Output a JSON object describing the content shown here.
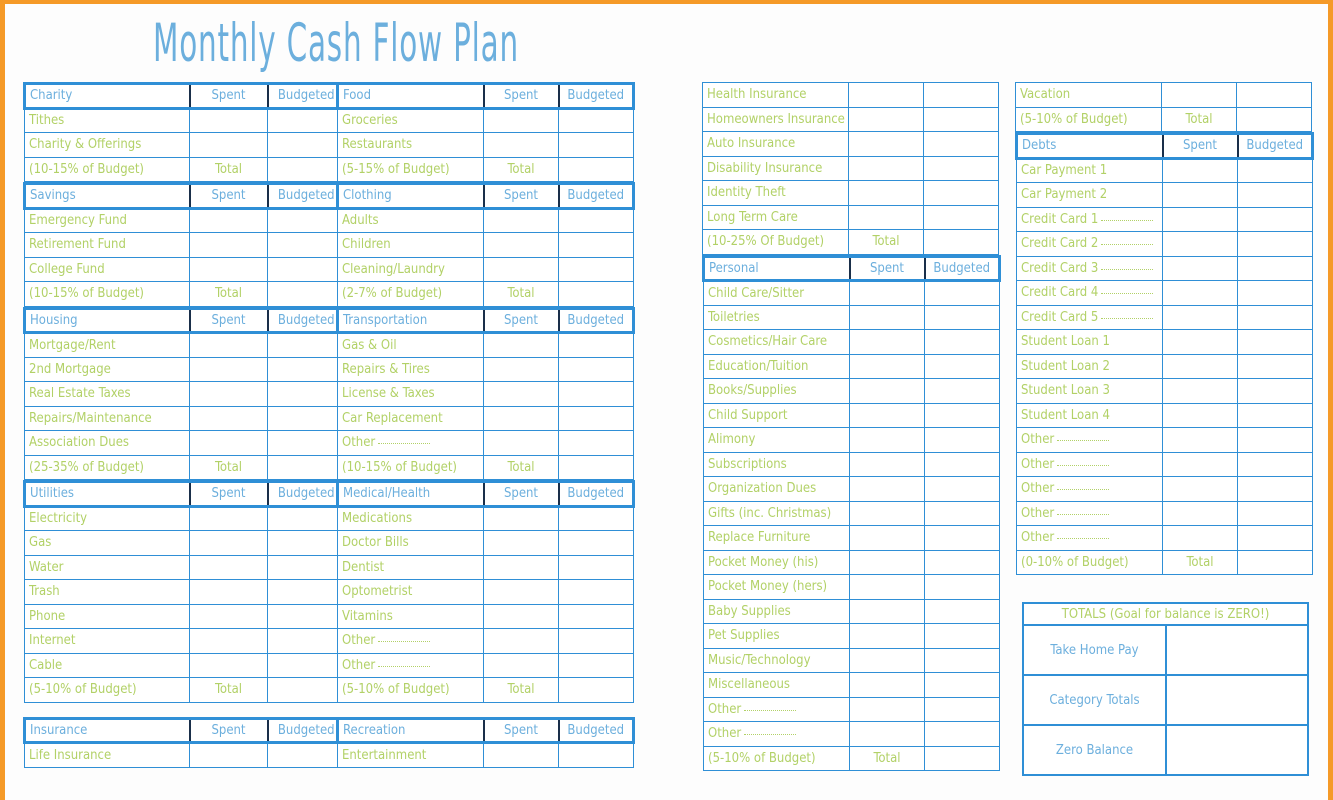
{
  "page": {
    "title": "Monthly Cash Flow Plan",
    "frame_color": "#f59a28",
    "border_color": "#2f8fd6",
    "header_text_color": "#6cafdd",
    "row_text_color": "#b2d167"
  },
  "labels": {
    "spent": "Spent",
    "budgeted": "Budgeted",
    "total": "Total",
    "blank": ""
  },
  "columns": [
    {
      "sections": [
        {
          "header": "Charity",
          "spent": "Spent",
          "budgeted": "Budgeted",
          "rows": [
            {
              "label": "Tithes",
              "spent": "",
              "budgeted": ""
            },
            {
              "label": "Charity & Offerings",
              "spent": "",
              "budgeted": ""
            },
            {
              "label": "(10-15% of Budget)",
              "spent": "Total",
              "budgeted": ""
            }
          ]
        },
        {
          "header": "Savings",
          "spent": "Spent",
          "budgeted": "Budgeted",
          "rows": [
            {
              "label": "Emergency Fund",
              "spent": "",
              "budgeted": ""
            },
            {
              "label": "Retirement Fund",
              "spent": "",
              "budgeted": ""
            },
            {
              "label": "College Fund",
              "spent": "",
              "budgeted": ""
            },
            {
              "label": "(10-15% of Budget)",
              "spent": "Total",
              "budgeted": ""
            }
          ]
        },
        {
          "header": "Housing",
          "spent": "Spent",
          "budgeted": "Budgeted",
          "rows": [
            {
              "label": "Mortgage/Rent",
              "spent": "",
              "budgeted": ""
            },
            {
              "label": "2nd Mortgage",
              "spent": "",
              "budgeted": ""
            },
            {
              "label": "Real Estate Taxes",
              "spent": "",
              "budgeted": ""
            },
            {
              "label": "Repairs/Maintenance",
              "spent": "",
              "budgeted": ""
            },
            {
              "label": "Association Dues",
              "spent": "",
              "budgeted": ""
            },
            {
              "label": "(25-35% of Budget)",
              "spent": "Total",
              "budgeted": ""
            }
          ]
        },
        {
          "header": "Utilities",
          "spent": "Spent",
          "budgeted": "Budgeted",
          "rows": [
            {
              "label": "Electricity",
              "spent": "",
              "budgeted": ""
            },
            {
              "label": "Gas",
              "spent": "",
              "budgeted": ""
            },
            {
              "label": "Water",
              "spent": "",
              "budgeted": ""
            },
            {
              "label": "Trash",
              "spent": "",
              "budgeted": ""
            },
            {
              "label": "Phone",
              "spent": "",
              "budgeted": ""
            },
            {
              "label": "Internet",
              "spent": "",
              "budgeted": ""
            },
            {
              "label": "Cable",
              "spent": "",
              "budgeted": ""
            },
            {
              "label": "(5-10% of Budget)",
              "spent": "Total",
              "budgeted": ""
            }
          ]
        },
        {
          "header": "Insurance",
          "spent": "Spent",
          "budgeted": "Budgeted",
          "rows": [
            {
              "label": "Life Insurance",
              "spent": "",
              "budgeted": ""
            }
          ]
        }
      ]
    },
    {
      "sections": [
        {
          "header": "Food",
          "spent": "Spent",
          "budgeted": "Budgeted",
          "rows": [
            {
              "label": "Groceries",
              "spent": "",
              "budgeted": ""
            },
            {
              "label": "Restaurants",
              "spent": "",
              "budgeted": ""
            },
            {
              "label": "(5-15% of Budget)",
              "spent": "Total",
              "budgeted": ""
            }
          ]
        },
        {
          "header": "Clothing",
          "spent": "Spent",
          "budgeted": "Budgeted",
          "rows": [
            {
              "label": "Adults",
              "spent": "",
              "budgeted": ""
            },
            {
              "label": "Children",
              "spent": "",
              "budgeted": ""
            },
            {
              "label": "Cleaning/Laundry",
              "spent": "",
              "budgeted": ""
            },
            {
              "label": "(2-7% of Budget)",
              "spent": "Total",
              "budgeted": ""
            }
          ]
        },
        {
          "header": "Transportation",
          "spent": "Spent",
          "budgeted": "Budgeted",
          "rows": [
            {
              "label": "Gas & Oil",
              "spent": "",
              "budgeted": ""
            },
            {
              "label": "Repairs & Tires",
              "spent": "",
              "budgeted": ""
            },
            {
              "label": "License & Taxes",
              "spent": "",
              "budgeted": ""
            },
            {
              "label": "Car Replacement",
              "spent": "",
              "budgeted": ""
            },
            {
              "label": "Other",
              "underline": true,
              "spent": "",
              "budgeted": ""
            },
            {
              "label": "(10-15% of Budget)",
              "spent": "Total",
              "budgeted": ""
            }
          ]
        },
        {
          "header": "Medical/Health",
          "spent": "Spent",
          "budgeted": "Budgeted",
          "rows": [
            {
              "label": "Medications",
              "spent": "",
              "budgeted": ""
            },
            {
              "label": "Doctor Bills",
              "spent": "",
              "budgeted": ""
            },
            {
              "label": "Dentist",
              "spent": "",
              "budgeted": ""
            },
            {
              "label": "Optometrist",
              "spent": "",
              "budgeted": ""
            },
            {
              "label": "Vitamins",
              "spent": "",
              "budgeted": ""
            },
            {
              "label": "Other",
              "underline": true,
              "spent": "",
              "budgeted": ""
            },
            {
              "label": "Other",
              "underline": true,
              "spent": "",
              "budgeted": ""
            },
            {
              "label": "(5-10% of Budget)",
              "spent": "Total",
              "budgeted": ""
            }
          ]
        },
        {
          "header": "Recreation",
          "spent": "Spent",
          "budgeted": "Budgeted",
          "rows": [
            {
              "label": "Entertainment",
              "spent": "",
              "budgeted": ""
            }
          ]
        }
      ]
    },
    {
      "sections": [
        {
          "header": null,
          "rows": [
            {
              "label": "Health Insurance",
              "spent": "",
              "budgeted": ""
            },
            {
              "label": "Homeowners Insurance",
              "spent": "",
              "budgeted": ""
            },
            {
              "label": "Auto Insurance",
              "spent": "",
              "budgeted": ""
            },
            {
              "label": "Disability Insurance",
              "spent": "",
              "budgeted": ""
            },
            {
              "label": "Identity Theft",
              "spent": "",
              "budgeted": ""
            },
            {
              "label": "Long Term Care",
              "spent": "",
              "budgeted": ""
            },
            {
              "label": "(10-25% Of Budget)",
              "spent": "Total",
              "budgeted": ""
            }
          ]
        },
        {
          "header": "Personal",
          "spent": "Spent",
          "budgeted": "Budgeted",
          "rows": [
            {
              "label": "Child Care/Sitter",
              "spent": "",
              "budgeted": ""
            },
            {
              "label": "Toiletries",
              "spent": "",
              "budgeted": ""
            },
            {
              "label": "Cosmetics/Hair Care",
              "spent": "",
              "budgeted": ""
            },
            {
              "label": "Education/Tuition",
              "spent": "",
              "budgeted": ""
            },
            {
              "label": "Books/Supplies",
              "spent": "",
              "budgeted": ""
            },
            {
              "label": "Child Support",
              "spent": "",
              "budgeted": ""
            },
            {
              "label": "Alimony",
              "spent": "",
              "budgeted": ""
            },
            {
              "label": "Subscriptions",
              "spent": "",
              "budgeted": ""
            },
            {
              "label": "Organization Dues",
              "spent": "",
              "budgeted": ""
            },
            {
              "label": "Gifts (inc. Christmas)",
              "spent": "",
              "budgeted": ""
            },
            {
              "label": "Replace Furniture",
              "spent": "",
              "budgeted": ""
            },
            {
              "label": "Pocket Money (his)",
              "spent": "",
              "budgeted": ""
            },
            {
              "label": "Pocket Money (hers)",
              "spent": "",
              "budgeted": ""
            },
            {
              "label": "Baby Supplies",
              "spent": "",
              "budgeted": ""
            },
            {
              "label": "Pet Supplies",
              "spent": "",
              "budgeted": ""
            },
            {
              "label": "Music/Technology",
              "spent": "",
              "budgeted": ""
            },
            {
              "label": "Miscellaneous",
              "spent": "",
              "budgeted": ""
            },
            {
              "label": "Other",
              "underline": true,
              "spent": "",
              "budgeted": ""
            },
            {
              "label": "Other",
              "underline": true,
              "spent": "",
              "budgeted": ""
            },
            {
              "label": "(5-10% of Budget)",
              "spent": "Total",
              "budgeted": ""
            }
          ]
        }
      ]
    },
    {
      "sections": [
        {
          "header": null,
          "rows": [
            {
              "label": "Vacation",
              "spent": "",
              "budgeted": ""
            },
            {
              "label": "(5-10% of Budget)",
              "spent": "Total",
              "budgeted": ""
            }
          ]
        },
        {
          "header": "Debts",
          "spent": "Spent",
          "budgeted": "Budgeted",
          "rows": [
            {
              "label": "Car Payment 1",
              "spent": "",
              "budgeted": ""
            },
            {
              "label": "Car Payment 2",
              "spent": "",
              "budgeted": ""
            },
            {
              "label": "Credit Card 1",
              "underline": true,
              "spent": "",
              "budgeted": ""
            },
            {
              "label": "Credit Card 2",
              "underline": true,
              "spent": "",
              "budgeted": ""
            },
            {
              "label": "Credit Card 3",
              "underline": true,
              "spent": "",
              "budgeted": ""
            },
            {
              "label": "Credit Card 4",
              "underline": true,
              "spent": "",
              "budgeted": ""
            },
            {
              "label": "Credit Card 5",
              "underline": true,
              "spent": "",
              "budgeted": ""
            },
            {
              "label": "Student Loan 1",
              "spent": "",
              "budgeted": ""
            },
            {
              "label": "Student Loan 2",
              "spent": "",
              "budgeted": ""
            },
            {
              "label": "Student Loan 3",
              "spent": "",
              "budgeted": ""
            },
            {
              "label": "Student Loan 4",
              "spent": "",
              "budgeted": ""
            },
            {
              "label": "Other",
              "underline": true,
              "spent": "",
              "budgeted": ""
            },
            {
              "label": "Other",
              "underline": true,
              "spent": "",
              "budgeted": ""
            },
            {
              "label": "Other",
              "underline": true,
              "spent": "",
              "budgeted": ""
            },
            {
              "label": "Other",
              "underline": true,
              "spent": "",
              "budgeted": ""
            },
            {
              "label": "Other",
              "underline": true,
              "spent": "",
              "budgeted": ""
            },
            {
              "label": "(0-10% of Budget)",
              "spent": "Total",
              "budgeted": ""
            }
          ]
        }
      ]
    }
  ],
  "totals": {
    "title": "TOTALS (Goal for balance is ZERO!)",
    "rows": [
      {
        "label": "Take Home Pay",
        "value": ""
      },
      {
        "label": "Category Totals",
        "value": ""
      },
      {
        "label": "Zero Balance",
        "value": ""
      }
    ]
  }
}
